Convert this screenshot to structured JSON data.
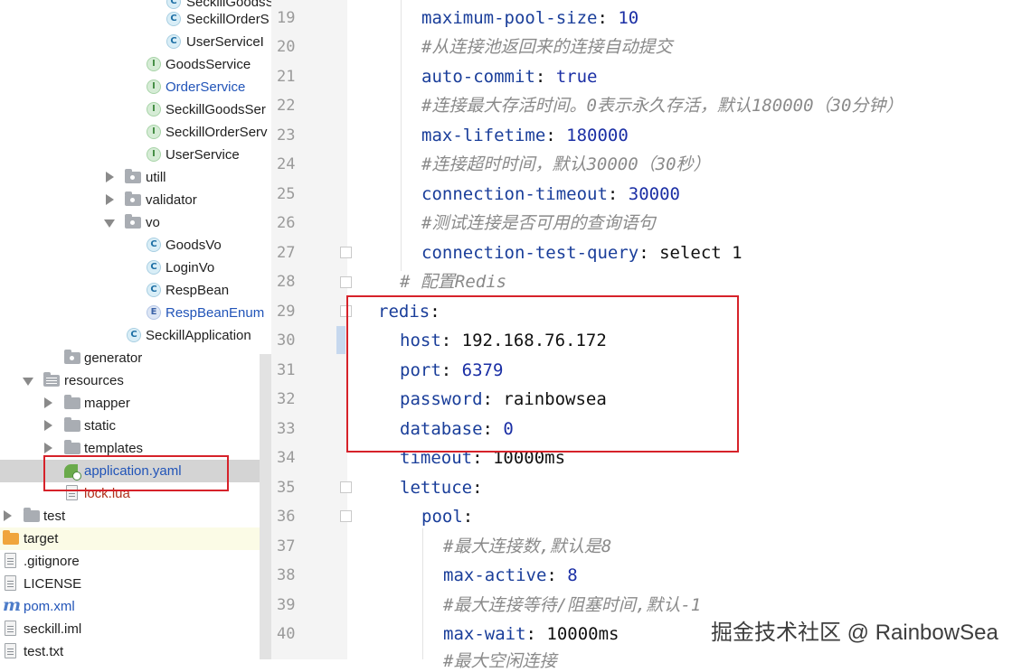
{
  "project_tree": {
    "items": [
      {
        "label": "SeckillGoodsS",
        "icon": "class-icon"
      },
      {
        "label": "SeckillOrderS",
        "icon": "class-icon"
      },
      {
        "label": "UserServiceI",
        "icon": "class-icon"
      },
      {
        "label": "GoodsService",
        "icon": "interface-icon"
      },
      {
        "label": "OrderService",
        "icon": "interface-icon"
      },
      {
        "label": "SeckillGoodsSer",
        "icon": "interface-icon"
      },
      {
        "label": "SeckillOrderServ",
        "icon": "interface-icon"
      },
      {
        "label": "UserService",
        "icon": "interface-icon"
      },
      {
        "label": "utill",
        "icon": "package-icon"
      },
      {
        "label": "validator",
        "icon": "package-icon"
      },
      {
        "label": "vo",
        "icon": "package-icon"
      },
      {
        "label": "GoodsVo",
        "icon": "class-icon"
      },
      {
        "label": "LoginVo",
        "icon": "class-icon"
      },
      {
        "label": "RespBean",
        "icon": "class-icon"
      },
      {
        "label": "RespBeanEnum",
        "icon": "enum-icon"
      },
      {
        "label": "SeckillApplication",
        "icon": "spring-class-icon"
      },
      {
        "label": "generator",
        "icon": "package-icon"
      },
      {
        "label": "resources",
        "icon": "resources-folder-icon"
      },
      {
        "label": "mapper",
        "icon": "folder-icon"
      },
      {
        "label": "static",
        "icon": "folder-icon"
      },
      {
        "label": "templates",
        "icon": "folder-icon"
      },
      {
        "label": "application.yaml",
        "icon": "spring-config-icon"
      },
      {
        "label": "lock.lua",
        "icon": "file-icon"
      },
      {
        "label": "test",
        "icon": "folder-icon"
      },
      {
        "label": "target",
        "icon": "folder-orange-icon"
      },
      {
        "label": ".gitignore",
        "icon": "file-icon"
      },
      {
        "label": "LICENSE",
        "icon": "file-icon"
      },
      {
        "label": "pom.xml",
        "icon": "maven-icon"
      },
      {
        "label": "seckill.iml",
        "icon": "file-icon"
      },
      {
        "label": "test.txt",
        "icon": "file-icon"
      }
    ]
  },
  "editor": {
    "line_numbers": [
      "19",
      "20",
      "21",
      "22",
      "23",
      "24",
      "25",
      "26",
      "27",
      "28",
      "29",
      "30",
      "31",
      "32",
      "33",
      "34",
      "35",
      "36",
      "37",
      "38",
      "39",
      "40"
    ],
    "lines": {
      "l19": {
        "key": "maximum-pool-size",
        "value": "10"
      },
      "l20": {
        "comment": "#从连接池返回来的连接自动提交"
      },
      "l21": {
        "key": "auto-commit",
        "value": "true"
      },
      "l22": {
        "comment": "#连接最大存活时间。0表示永久存活，默认180000（30分钟）"
      },
      "l23": {
        "key": "max-lifetime",
        "value": "180000"
      },
      "l24": {
        "comment": "#连接超时时间，默认30000（30秒）"
      },
      "l25": {
        "key": "connection-timeout",
        "value": "30000"
      },
      "l26": {
        "comment": "#测试连接是否可用的查询语句"
      },
      "l27": {
        "key": "connection-test-query",
        "value": "select 1"
      },
      "l28": {
        "comment": "#  配置Redis"
      },
      "l29": {
        "key": "redis",
        "value": ""
      },
      "l30": {
        "key": "host",
        "value": "192.168.76.172"
      },
      "l31": {
        "key": "port",
        "value": "6379"
      },
      "l32": {
        "key": "password",
        "value": "rainbowsea"
      },
      "l33": {
        "key": "database",
        "value": "0"
      },
      "l34": {
        "key": "timeout",
        "value": "10000ms"
      },
      "l35": {
        "key": "lettuce",
        "value": ""
      },
      "l36": {
        "key": "pool",
        "value": ""
      },
      "l37": {
        "comment": "#最大连接数,默认是8"
      },
      "l38": {
        "key": "max-active",
        "value": "8"
      },
      "l39": {
        "comment": "#最大连接等待/阻塞时间,默认-1"
      },
      "l40": {
        "key": "max-wait",
        "value": "10000ms"
      },
      "l41": {
        "comment": "#最大空闲连接"
      }
    }
  },
  "watermark": "掘金技术社区 @ RainbowSea",
  "colors": {
    "highlight_box": "#d6222a",
    "key": "#1a3e9a",
    "comment": "#8a8a8a"
  }
}
